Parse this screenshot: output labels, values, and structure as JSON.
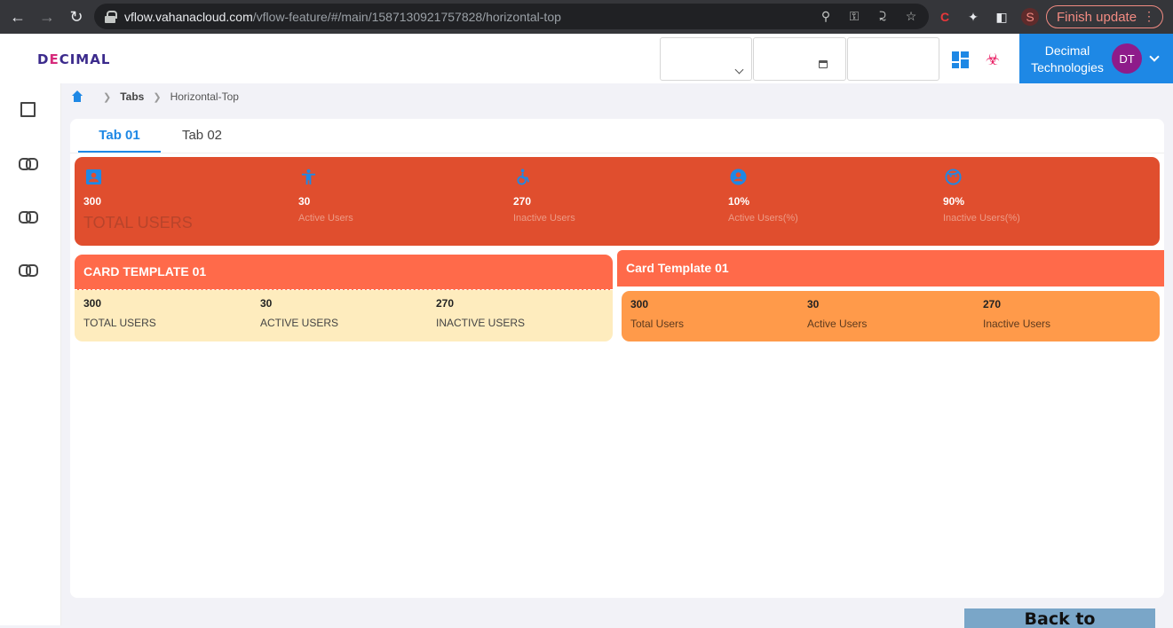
{
  "browser": {
    "url_host": "vflow.vahanacloud.com",
    "url_path": "/vflow-feature/#/main/1587130921757828/horizontal-top",
    "finish_update": "Finish update",
    "profile_initial": "S"
  },
  "header": {
    "logo_d": "D",
    "logo_e": "E",
    "logo_rest": "CIMAL",
    "user_line1": "Decimal",
    "user_line2": "Technologies",
    "avatar_initials": "DT"
  },
  "breadcrumb": {
    "items": [
      "Tabs",
      "Horizontal-Top"
    ]
  },
  "tabs": [
    {
      "label": "Tab 01",
      "active": true
    },
    {
      "label": "Tab 02",
      "active": false
    }
  ],
  "stats": [
    {
      "value": "300",
      "label": "TOTAL USERS",
      "icon": "contact-card-icon"
    },
    {
      "value": "30",
      "label": "Active Users",
      "icon": "accessibility-icon"
    },
    {
      "value": "270",
      "label": "Inactive Users",
      "icon": "wheelchair-icon"
    },
    {
      "value": "10%",
      "label": "Active Users(%)",
      "icon": "account-circle-icon"
    },
    {
      "value": "90%",
      "label": "Inactive Users(%)",
      "icon": "face-icon"
    }
  ],
  "card_left": {
    "title": "CARD TEMPLATE 01",
    "metrics": [
      {
        "value": "300",
        "label": "TOTAL USERS"
      },
      {
        "value": "30",
        "label": "ACTIVE USERS"
      },
      {
        "value": "270",
        "label": "INACTIVE USERS"
      }
    ]
  },
  "card_right": {
    "title": "Card Template 01",
    "metrics": [
      {
        "value": "300",
        "label": "Total Users"
      },
      {
        "value": "30",
        "label": "Active Users"
      },
      {
        "value": "270",
        "label": "Inactive Users"
      }
    ]
  },
  "back_link": "Back to Components",
  "colors": {
    "accent": "#1e88e5",
    "stats_band": "#e04e2e",
    "card_header": "#ff6a4a",
    "card_left_body": "#feecbe",
    "card_right_body": "#ff9a4a"
  }
}
